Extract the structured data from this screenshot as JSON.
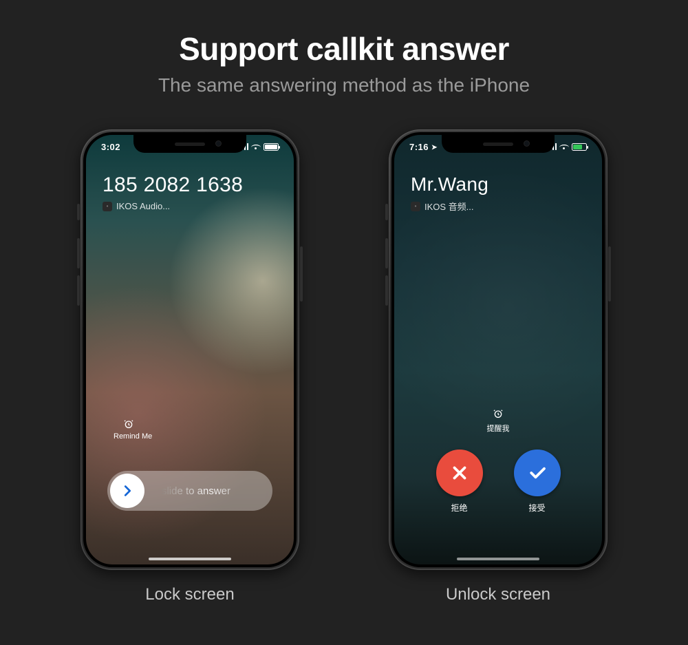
{
  "page": {
    "title": "Support callkit answer",
    "subtitle": "The same answering method as the iPhone"
  },
  "lock": {
    "caption": "Lock screen",
    "status_time": "3:02",
    "caller_title": "185 2082 1638",
    "caller_app": "IKOS Audio...",
    "remind_label": "Remind Me",
    "slide_label": "slide to answer"
  },
  "unlock": {
    "caption": "Unlock screen",
    "status_time": "7:16",
    "caller_title": "Mr.Wang",
    "caller_app": "IKOS 音频...",
    "remind_label": "提醒我",
    "decline_label": "拒绝",
    "accept_label": "接受"
  }
}
